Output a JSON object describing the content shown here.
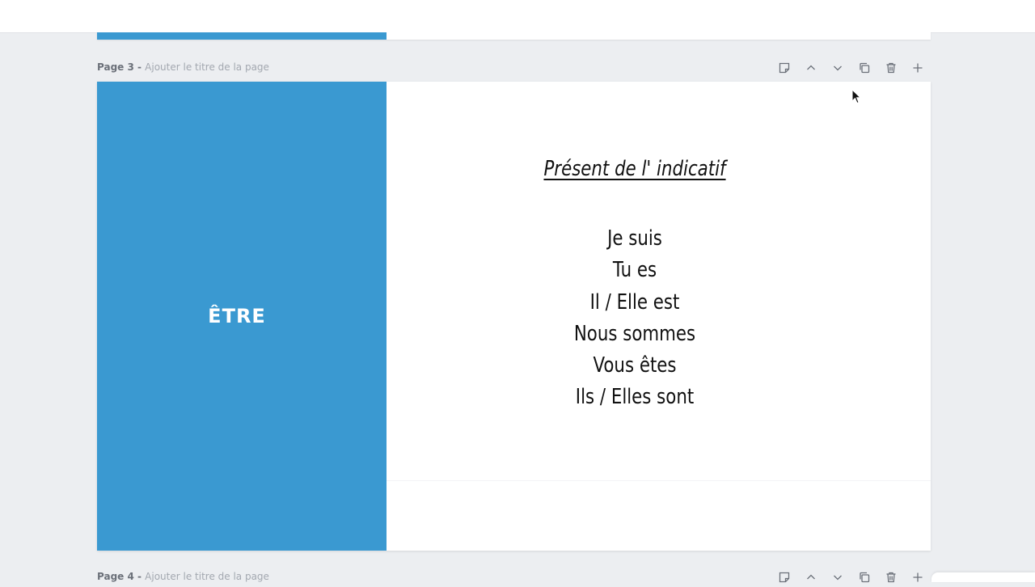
{
  "colors": {
    "accent_blue": "#3a99d1",
    "canvas_bg": "#eceef1"
  },
  "page3": {
    "number_label": "Page 3",
    "separator": " - ",
    "title_placeholder": "Ajouter le titre de la page",
    "toolbar": {
      "notes_icon": "note-icon",
      "move_up_icon": "chevron-up-icon",
      "move_down_icon": "chevron-down-icon",
      "duplicate_icon": "copy-icon",
      "delete_icon": "trash-icon",
      "add_icon": "plus-icon"
    },
    "slide": {
      "verb": "ÊTRE",
      "tense_heading": "Présent de l' indicatif",
      "conjugations": [
        "Je suis",
        "Tu es",
        "Il / Elle est",
        "Nous sommes",
        "Vous êtes",
        "Ils / Elles sont"
      ]
    }
  },
  "page4": {
    "number_label": "Page 4",
    "separator": " - ",
    "title_placeholder": "Ajouter le titre de la page"
  }
}
